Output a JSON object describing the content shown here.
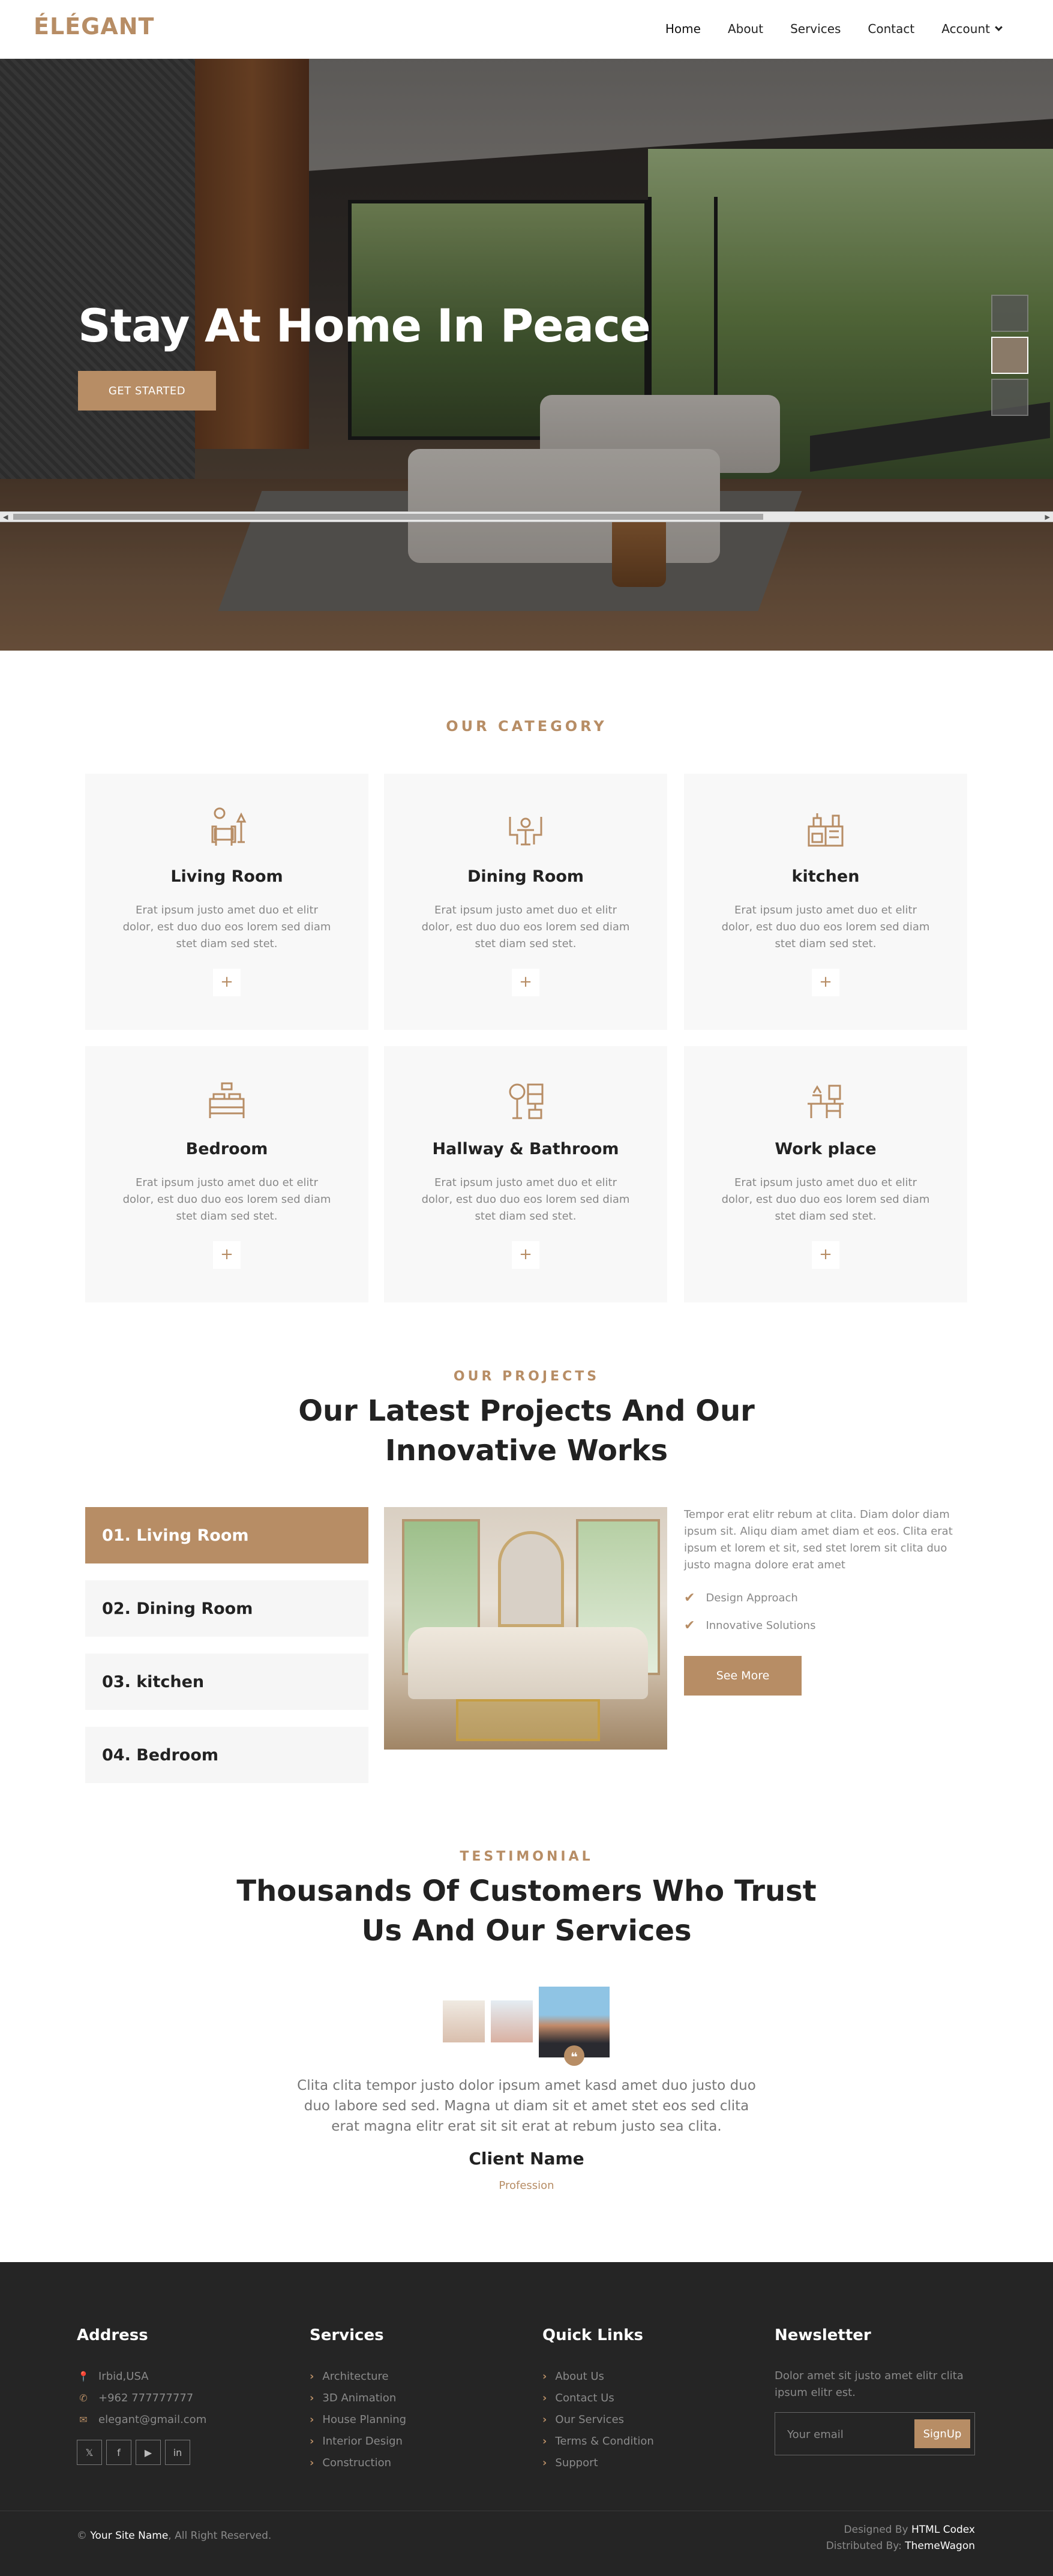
{
  "brand": {
    "logo": "ÉLÉGANT",
    "accent": "#b78d65"
  },
  "nav": {
    "items": [
      {
        "label": "Home"
      },
      {
        "label": "About"
      },
      {
        "label": "Services"
      },
      {
        "label": "Contact"
      },
      {
        "label": "Account"
      }
    ]
  },
  "hero": {
    "title": "Stay At Home In Peace",
    "cta": "GET STARTED"
  },
  "category": {
    "tag": "OUR CATEGORY",
    "cards": [
      {
        "icon": "living-room-icon",
        "name": "Living Room",
        "desc": "Erat ipsum justo amet duo et elitr dolor, est duo duo eos lorem sed diam stet diam sed stet.",
        "plus": "+"
      },
      {
        "icon": "dining-room-icon",
        "name": "Dining Room",
        "desc": "Erat ipsum justo amet duo et elitr dolor, est duo duo eos lorem sed diam stet diam sed stet.",
        "plus": "+"
      },
      {
        "icon": "kitchen-icon",
        "name": "kitchen",
        "desc": "Erat ipsum justo amet duo et elitr dolor, est duo duo eos lorem sed diam stet diam sed stet.",
        "plus": "+"
      },
      {
        "icon": "bedroom-icon",
        "name": "Bedroom",
        "desc": "Erat ipsum justo amet duo et elitr dolor, est duo duo eos lorem sed diam stet diam sed stet.",
        "plus": "+"
      },
      {
        "icon": "bathroom-icon",
        "name": "Hallway & Bathroom",
        "desc": "Erat ipsum justo amet duo et elitr dolor, est duo duo eos lorem sed diam stet diam sed stet.",
        "plus": "+"
      },
      {
        "icon": "workplace-icon",
        "name": "Work place",
        "desc": "Erat ipsum justo amet duo et elitr dolor, est duo duo eos lorem sed diam stet diam sed stet.",
        "plus": "+"
      }
    ]
  },
  "projects": {
    "tag": "OUR PROJECTS",
    "title_line1": "Our Latest Projects And Our",
    "title_line2": "Innovative Works",
    "tabs": [
      {
        "label": "01. Living Room"
      },
      {
        "label": "02. Dining Room"
      },
      {
        "label": "03. kitchen"
      },
      {
        "label": "04. Bedroom"
      }
    ],
    "text": "Tempor erat elitr rebum at clita. Diam dolor diam ipsum sit. Aliqu diam amet diam et eos. Clita erat ipsum et lorem et sit, sed stet lorem sit clita duo justo magna dolore erat amet",
    "checks": [
      "Design Approach",
      "Innovative Solutions"
    ],
    "button": "See More"
  },
  "testimonial": {
    "tag": "TESTIMONIAL",
    "title_line1": "Thousands Of Customers Who Trust",
    "title_line2": "Us And Our Services",
    "quote": "Clita clita tempor justo dolor ipsum amet kasd amet duo justo duo duo labore sed sed. Magna ut diam sit et amet stet eos sed clita erat magna elitr erat sit sit erat at rebum justo sea clita.",
    "client": "Client Name",
    "profession": "Profession"
  },
  "footer": {
    "address": {
      "title": "Address",
      "items": [
        {
          "icon": "location-icon",
          "text": "Irbid,USA"
        },
        {
          "icon": "phone-icon",
          "text": "+962 777777777"
        },
        {
          "icon": "mail-icon",
          "text": "elegant@gmail.com"
        }
      ],
      "social": [
        {
          "icon": "twitter-icon",
          "glyph": "𝕏"
        },
        {
          "icon": "facebook-icon",
          "glyph": "f"
        },
        {
          "icon": "youtube-icon",
          "glyph": "▶"
        },
        {
          "icon": "linkedin-icon",
          "glyph": "in"
        }
      ]
    },
    "services": {
      "title": "Services",
      "items": [
        "Architecture",
        "3D Animation",
        "House Planning",
        "Interior Design",
        "Construction"
      ]
    },
    "quick_links": {
      "title": "Quick Links",
      "items": [
        "About Us",
        "Contact Us",
        "Our Services",
        "Terms & Condition",
        "Support"
      ]
    },
    "newsletter": {
      "title": "Newsletter",
      "text": "Dolor amet sit justo amet elitr clita ipsum elitr est.",
      "placeholder": "Your email",
      "button": "SignUp"
    },
    "copyright": {
      "prefix": "©",
      "site": "Your Site Name",
      "suffix": ", All Right Reserved."
    },
    "designed": {
      "label": "Designed By",
      "name": "HTML Codex"
    },
    "distributed": {
      "label": "Distributed By:",
      "name": "ThemeWagon"
    }
  }
}
